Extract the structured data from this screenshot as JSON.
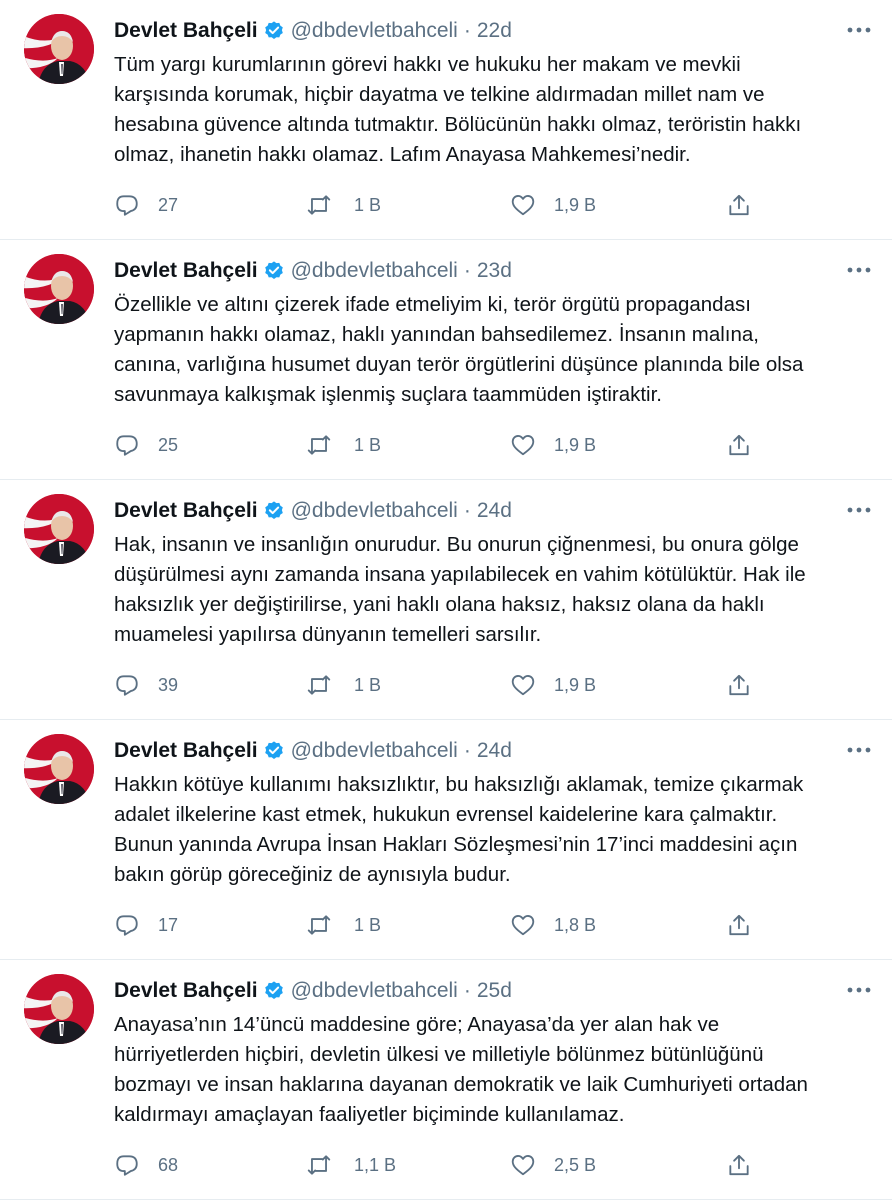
{
  "tweets": [
    {
      "author_name": "Devlet Bahçeli",
      "handle": "@dbdevletbahceli",
      "separator": "·",
      "time": "22d",
      "lines": [
        "Tüm yargı kurumlarının görevi hakkı ve hukuku her makam ve mevkii",
        "karşısında korumak, hiçbir dayatma ve telkine aldırmadan millet nam ve",
        "hesabına güvence altında tutmaktır. Bölücünün hakkı olmaz, teröristin hakkı",
        "olmaz, ihanetin hakkı olamaz. Lafım Anayasa Mahkemesi’nedir."
      ],
      "replies": "27",
      "retweets": "1 B",
      "likes": "1,9 B"
    },
    {
      "author_name": "Devlet Bahçeli",
      "handle": "@dbdevletbahceli",
      "separator": "·",
      "time": "23d",
      "lines": [
        "Özellikle ve altını çizerek ifade etmeliyim ki, terör örgütü propagandası",
        "yapmanın hakkı olamaz, haklı yanından bahsedilemez. İnsanın malına,",
        "canına, varlığına husumet duyan terör örgütlerini düşünce planında bile olsa",
        "savunmaya kalkışmak işlenmiş suçlara taammüden iştiraktir."
      ],
      "replies": "25",
      "retweets": "1 B",
      "likes": "1,9 B"
    },
    {
      "author_name": "Devlet Bahçeli",
      "handle": "@dbdevletbahceli",
      "separator": "·",
      "time": "24d",
      "lines": [
        "Hak, insanın ve insanlığın onurudur. Bu onurun çiğnenmesi, bu onura gölge",
        "düşürülmesi aynı zamanda insana yapılabilecek en vahim kötülüktür. Hak ile",
        "haksızlık yer değiştirilirse, yani haklı olana haksız, haksız olana da haklı",
        "muamelesi yapılırsa dünyanın temelleri sarsılır."
      ],
      "replies": "39",
      "retweets": "1 B",
      "likes": "1,9 B"
    },
    {
      "author_name": "Devlet Bahçeli",
      "handle": "@dbdevletbahceli",
      "separator": "·",
      "time": "24d",
      "lines": [
        "Hakkın kötüye kullanımı haksızlıktır, bu haksızlığı aklamak, temize çıkarmak",
        "adalet ilkelerine kast etmek, hukukun evrensel kaidelerine kara çalmaktır.",
        "Bunun yanında Avrupa İnsan Hakları Sözleşmesi’nin 17’inci maddesini açın",
        "bakın görüp göreceğiniz de aynısıyla budur."
      ],
      "replies": "17",
      "retweets": "1 B",
      "likes": "1,8 B"
    },
    {
      "author_name": "Devlet Bahçeli",
      "handle": "@dbdevletbahceli",
      "separator": "·",
      "time": "25d",
      "lines": [
        "Anayasa’nın 14’üncü maddesine göre; Anayasa’da yer alan hak ve",
        "hürriyetlerden hiçbiri, devletin ülkesi ve milletiyle bölünmez bütünlüğünü",
        "bozmayı ve insan haklarına dayanan demokratik ve laik Cumhuriyeti ortadan",
        "kaldırmayı amaçlayan faaliyetler biçiminde kullanılamaz."
      ],
      "replies": "68",
      "retweets": "1,1 B",
      "likes": "2,5 B"
    }
  ],
  "icons": {
    "verified": "verified-badge-icon",
    "more": "more-dots-icon",
    "reply": "reply-bubble-icon",
    "retweet": "retweet-arrows-icon",
    "like": "heart-icon",
    "share": "share-upload-icon",
    "avatar": "profile-photo"
  },
  "colors": {
    "text": "#0f1419",
    "secondary": "#5b7083",
    "verified": "#1da1f2",
    "divider": "#e6ecf0",
    "avatar_bg": "#c8102e"
  }
}
